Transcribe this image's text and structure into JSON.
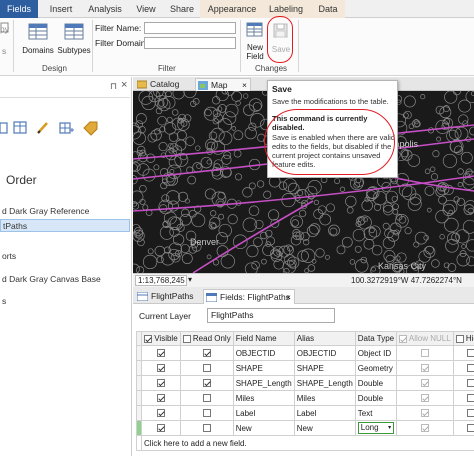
{
  "ribbon": {
    "tabs": [
      "Fields",
      "Insert",
      "Analysis",
      "View",
      "Share",
      "Appearance",
      "Labeling",
      "Data"
    ],
    "active_tab": "Fields",
    "edge_label_top": "py",
    "edge_label_bottom": "s",
    "design": {
      "domains_label": "Domains",
      "subtypes_label": "Subtypes",
      "group_label": "Design"
    },
    "filter": {
      "name_label": "Filter Name:",
      "domain_label": "Filter Domain:",
      "group_label": "Filter"
    },
    "changes": {
      "new_field_label": "New\nField",
      "save_label": "Save",
      "group_label": "Changes"
    }
  },
  "left_pane": {
    "pin": "⊓",
    "close": "×",
    "title": "Order",
    "items": [
      "d Dark Gray Reference",
      "tPaths",
      "",
      "orts",
      "d Dark Gray Canvas Base",
      "s"
    ]
  },
  "view_tabs": {
    "catalog": "Catalog",
    "map": "Map",
    "close": "×"
  },
  "map": {
    "labels": [
      "Minneapolis",
      "Denver",
      "Kansas City"
    ],
    "scale": "1:13,768,245",
    "coords": "100.3272919°W 47.7262274°N"
  },
  "tooltip": {
    "title": "Save",
    "desc": "Save the modifications to the table.",
    "disabled_heading": "This command is currently disabled.",
    "disabled_text": "Save is enabled when there are valid edits to the fields, but disabled if the current project contains unsaved feature edits."
  },
  "fields_view": {
    "tabs": [
      "FlightPaths",
      "Fields:  FlightPaths"
    ],
    "close": "×",
    "current_layer_label": "Current Layer",
    "current_layer_value": "FlightPaths",
    "columns": [
      "",
      "Visible",
      "Read Only",
      "Field Name",
      "Alias",
      "Data Type",
      "Allow NULL",
      "Highli"
    ],
    "rows": [
      {
        "visible": true,
        "read_only": true,
        "field_name": "OBJECTID",
        "alias": "OBJECTID",
        "data_type": "Object ID",
        "allow_null": false,
        "grey": true
      },
      {
        "visible": true,
        "read_only": false,
        "field_name": "SHAPE",
        "alias": "SHAPE",
        "data_type": "Geometry",
        "allow_null": true,
        "grey": true
      },
      {
        "visible": true,
        "read_only": true,
        "field_name": "SHAPE_Length",
        "alias": "SHAPE_Length",
        "data_type": "Double",
        "allow_null": true,
        "grey": true
      },
      {
        "visible": true,
        "read_only": false,
        "field_name": "Miles",
        "alias": "Miles",
        "data_type": "Double",
        "allow_null": true,
        "grey": false
      },
      {
        "visible": true,
        "read_only": false,
        "field_name": "Label",
        "alias": "Label",
        "data_type": "Text",
        "allow_null": true,
        "grey": false
      },
      {
        "visible": true,
        "read_only": false,
        "field_name": "New",
        "alias": "New",
        "data_type": "Long",
        "allow_null": true,
        "grey": false
      }
    ],
    "add_row_text": "Click here to add a new field."
  },
  "colors": {
    "accent": "#2d5fa0",
    "annotation": "#e31b23",
    "appearance_tab_bg": "#f3e8da"
  }
}
